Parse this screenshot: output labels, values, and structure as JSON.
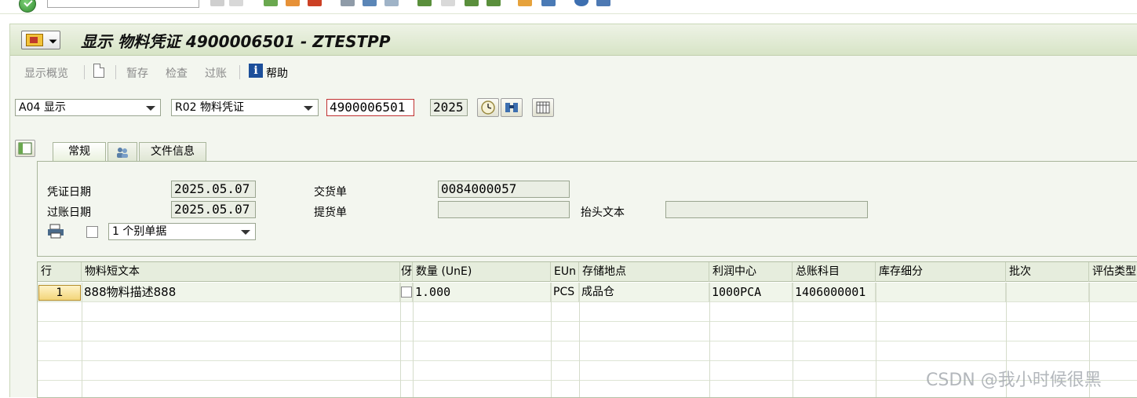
{
  "window": {
    "title": "显示 物料凭证 4900006501 - ZTESTPP"
  },
  "app_toolbar": {
    "overview": "显示概览",
    "hold": "暂存",
    "check": "检查",
    "post": "过账",
    "help": "帮助"
  },
  "selection": {
    "action": "A04 显示",
    "reference": "R02 物料凭证",
    "doc_number": "4900006501",
    "year": "2025"
  },
  "tabs": [
    {
      "label": "常规"
    },
    {
      "label": ""
    },
    {
      "label": "文件信息"
    }
  ],
  "header": {
    "doc_date_label": "凭证日期",
    "doc_date": "2025.05.07",
    "post_date_label": "过账日期",
    "post_date": "2025.05.07",
    "delivery_label": "交货单",
    "delivery": "0084000057",
    "bol_label": "提货单",
    "bol": "",
    "header_text_label": "抬头文本",
    "header_text": "",
    "print_option": "1 个别单据"
  },
  "table": {
    "columns": [
      "行",
      "物料短文本",
      "伢",
      "数量 (UnE)",
      "EUn",
      "存储地点",
      "利润中心",
      "总账科目",
      "库存细分",
      "批次",
      "评估类型"
    ],
    "rows": [
      {
        "line": "1",
        "text": "888物料描述888",
        "qty": "1.000",
        "uom": "PCS",
        "sloc": "成品仓",
        "profit_center": "1000PCA",
        "gl": "1406000001",
        "stock_seg": "",
        "batch": "",
        "val_type": ""
      }
    ]
  },
  "watermark": "CSDN @我小时候很黑",
  "colors": {
    "title_bg": "#d7e4c6",
    "panel_bg": "#f3f6ef",
    "row_button": "#f3d57a",
    "required_border": "#c03030"
  }
}
